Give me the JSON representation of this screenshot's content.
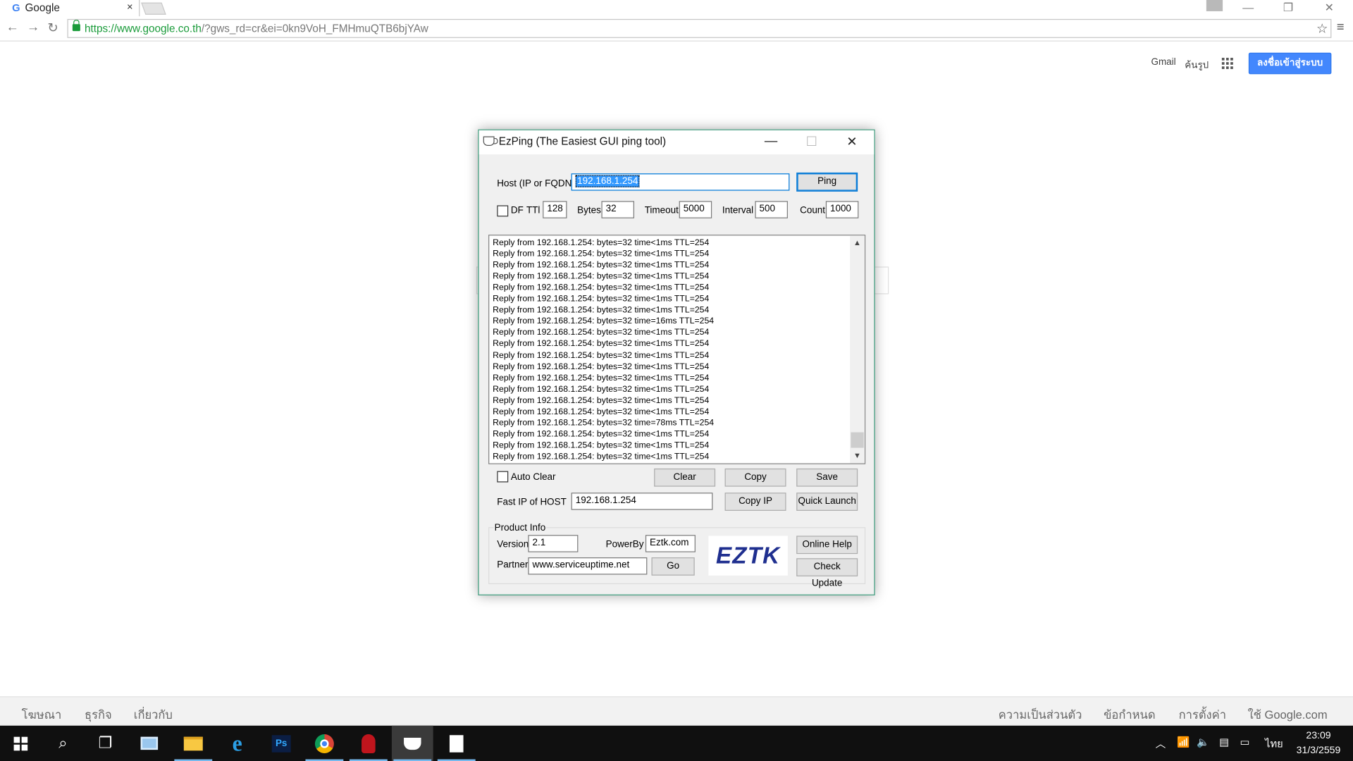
{
  "browser": {
    "tab_title": "Google",
    "tab_favicon": "G",
    "tab_close": "×",
    "url_host": "https://www.google.co.th",
    "url_rest": "/?gws_rd=cr&ei=0kn9VoH_FMHmuQTB6bjYAw"
  },
  "google": {
    "gmail": "Gmail",
    "images": "ค้นรูป",
    "signin": "ลงชื่อเข้าสู่ระบบ",
    "footer_left": [
      "โฆษณา",
      "ธุรกิจ",
      "เกี่ยวกับ"
    ],
    "footer_right": [
      "ความเป็นส่วนตัว",
      "ข้อกำหนด",
      "การตั้งค่า",
      "ใช้ Google.com"
    ]
  },
  "ezping": {
    "title": "EzPing (The Easiest GUI ping tool)",
    "host_label": "Host (IP or FQDN)",
    "host_value": "192.168.1.254",
    "ping_button": "Ping",
    "df_label": "DF",
    "ttl_label": "TTl",
    "ttl_value": "128",
    "bytes_label": "Bytes",
    "bytes_value": "32",
    "timeout_label": "Timeout",
    "timeout_value": "5000",
    "interval_label": "Interval",
    "interval_value": "500",
    "count_label": "Count",
    "count_value": "1000",
    "log_lines": [
      "Reply from 192.168.1.254: bytes=32 time<1ms TTL=254",
      "Reply from 192.168.1.254: bytes=32 time<1ms TTL=254",
      "Reply from 192.168.1.254: bytes=32 time<1ms TTL=254",
      "Reply from 192.168.1.254: bytes=32 time<1ms TTL=254",
      "Reply from 192.168.1.254: bytes=32 time<1ms TTL=254",
      "Reply from 192.168.1.254: bytes=32 time<1ms TTL=254",
      "Reply from 192.168.1.254: bytes=32 time<1ms TTL=254",
      "Reply from 192.168.1.254: bytes=32 time=16ms TTL=254",
      "Reply from 192.168.1.254: bytes=32 time<1ms TTL=254",
      "Reply from 192.168.1.254: bytes=32 time<1ms TTL=254",
      "Reply from 192.168.1.254: bytes=32 time<1ms TTL=254",
      "Reply from 192.168.1.254: bytes=32 time<1ms TTL=254",
      "Reply from 192.168.1.254: bytes=32 time<1ms TTL=254",
      "Reply from 192.168.1.254: bytes=32 time<1ms TTL=254",
      "Reply from 192.168.1.254: bytes=32 time<1ms TTL=254",
      "Reply from 192.168.1.254: bytes=32 time<1ms TTL=254",
      "Reply from 192.168.1.254: bytes=32 time=78ms TTL=254",
      "Reply from 192.168.1.254: bytes=32 time<1ms TTL=254",
      "Reply from 192.168.1.254: bytes=32 time<1ms TTL=254",
      "Reply from 192.168.1.254: bytes=32 time<1ms TTL=254"
    ],
    "auto_clear_label": "Auto Clear",
    "clear_button": "Clear",
    "copy_button": "Copy",
    "save_button": "Save",
    "fast_ip_label": "Fast IP of HOST",
    "fast_ip_value": "192.168.1.254",
    "copy_ip_button": "Copy IP",
    "quick_launch_button": "Quick Launch",
    "product_info_label": "Product Info",
    "version_label": "Version",
    "version_value": "2.1",
    "powerby_label": "PowerBy",
    "powerby_value": "Eztk.com",
    "partner_label": "Partner",
    "partner_value": "www.serviceuptime.net",
    "go_button": "Go",
    "logo_text": "EZTK",
    "online_help_button": "Online Help",
    "check_update_button": "Check Update"
  },
  "taskbar": {
    "language": "ไทย",
    "time": "23:09",
    "date": "31/3/2559"
  },
  "colors": {
    "url_green": "#1a9b3a",
    "signin_blue": "#4387fd",
    "selection": "#3399ff",
    "taskbar": "#101010",
    "window_border": "#3a9a7a"
  }
}
